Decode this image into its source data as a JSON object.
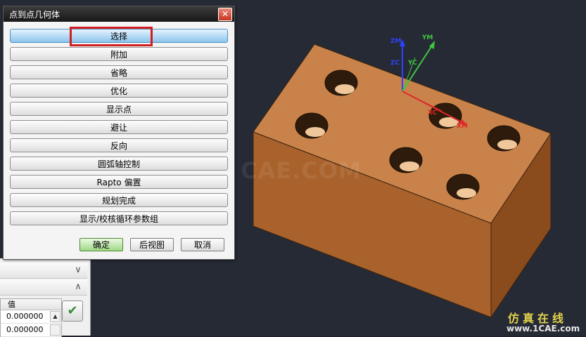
{
  "dialog": {
    "title": "点到点几何体",
    "options": [
      "选择",
      "附加",
      "省略",
      "优化",
      "显示点",
      "避让",
      "反向",
      "圆弧轴控制",
      "Rapto 偏置",
      "规划完成",
      "显示/校核循环参数组"
    ],
    "ok_label": "确定",
    "back_label": "后视图",
    "cancel_label": "取消"
  },
  "side_panel": {
    "value_header": "值",
    "values": [
      "0.000000",
      "0.000000"
    ]
  },
  "axes": {
    "zm": "ZM",
    "zc": "ZC",
    "ym": "YM",
    "yc": "YC",
    "xc": "XC",
    "xm": "XM"
  },
  "watermark": "CAE.COM",
  "brand": {
    "name_cn": "仿真在线",
    "url": "www.1CAE.com"
  },
  "colors": {
    "block_top": "#c9834a",
    "block_front": "#a9622c",
    "block_side": "#8a4b1d",
    "highlight": "#d21e1e",
    "axis_z": "#2c43ff",
    "axis_y": "#3fc63f",
    "axis_x": "#e02828"
  }
}
